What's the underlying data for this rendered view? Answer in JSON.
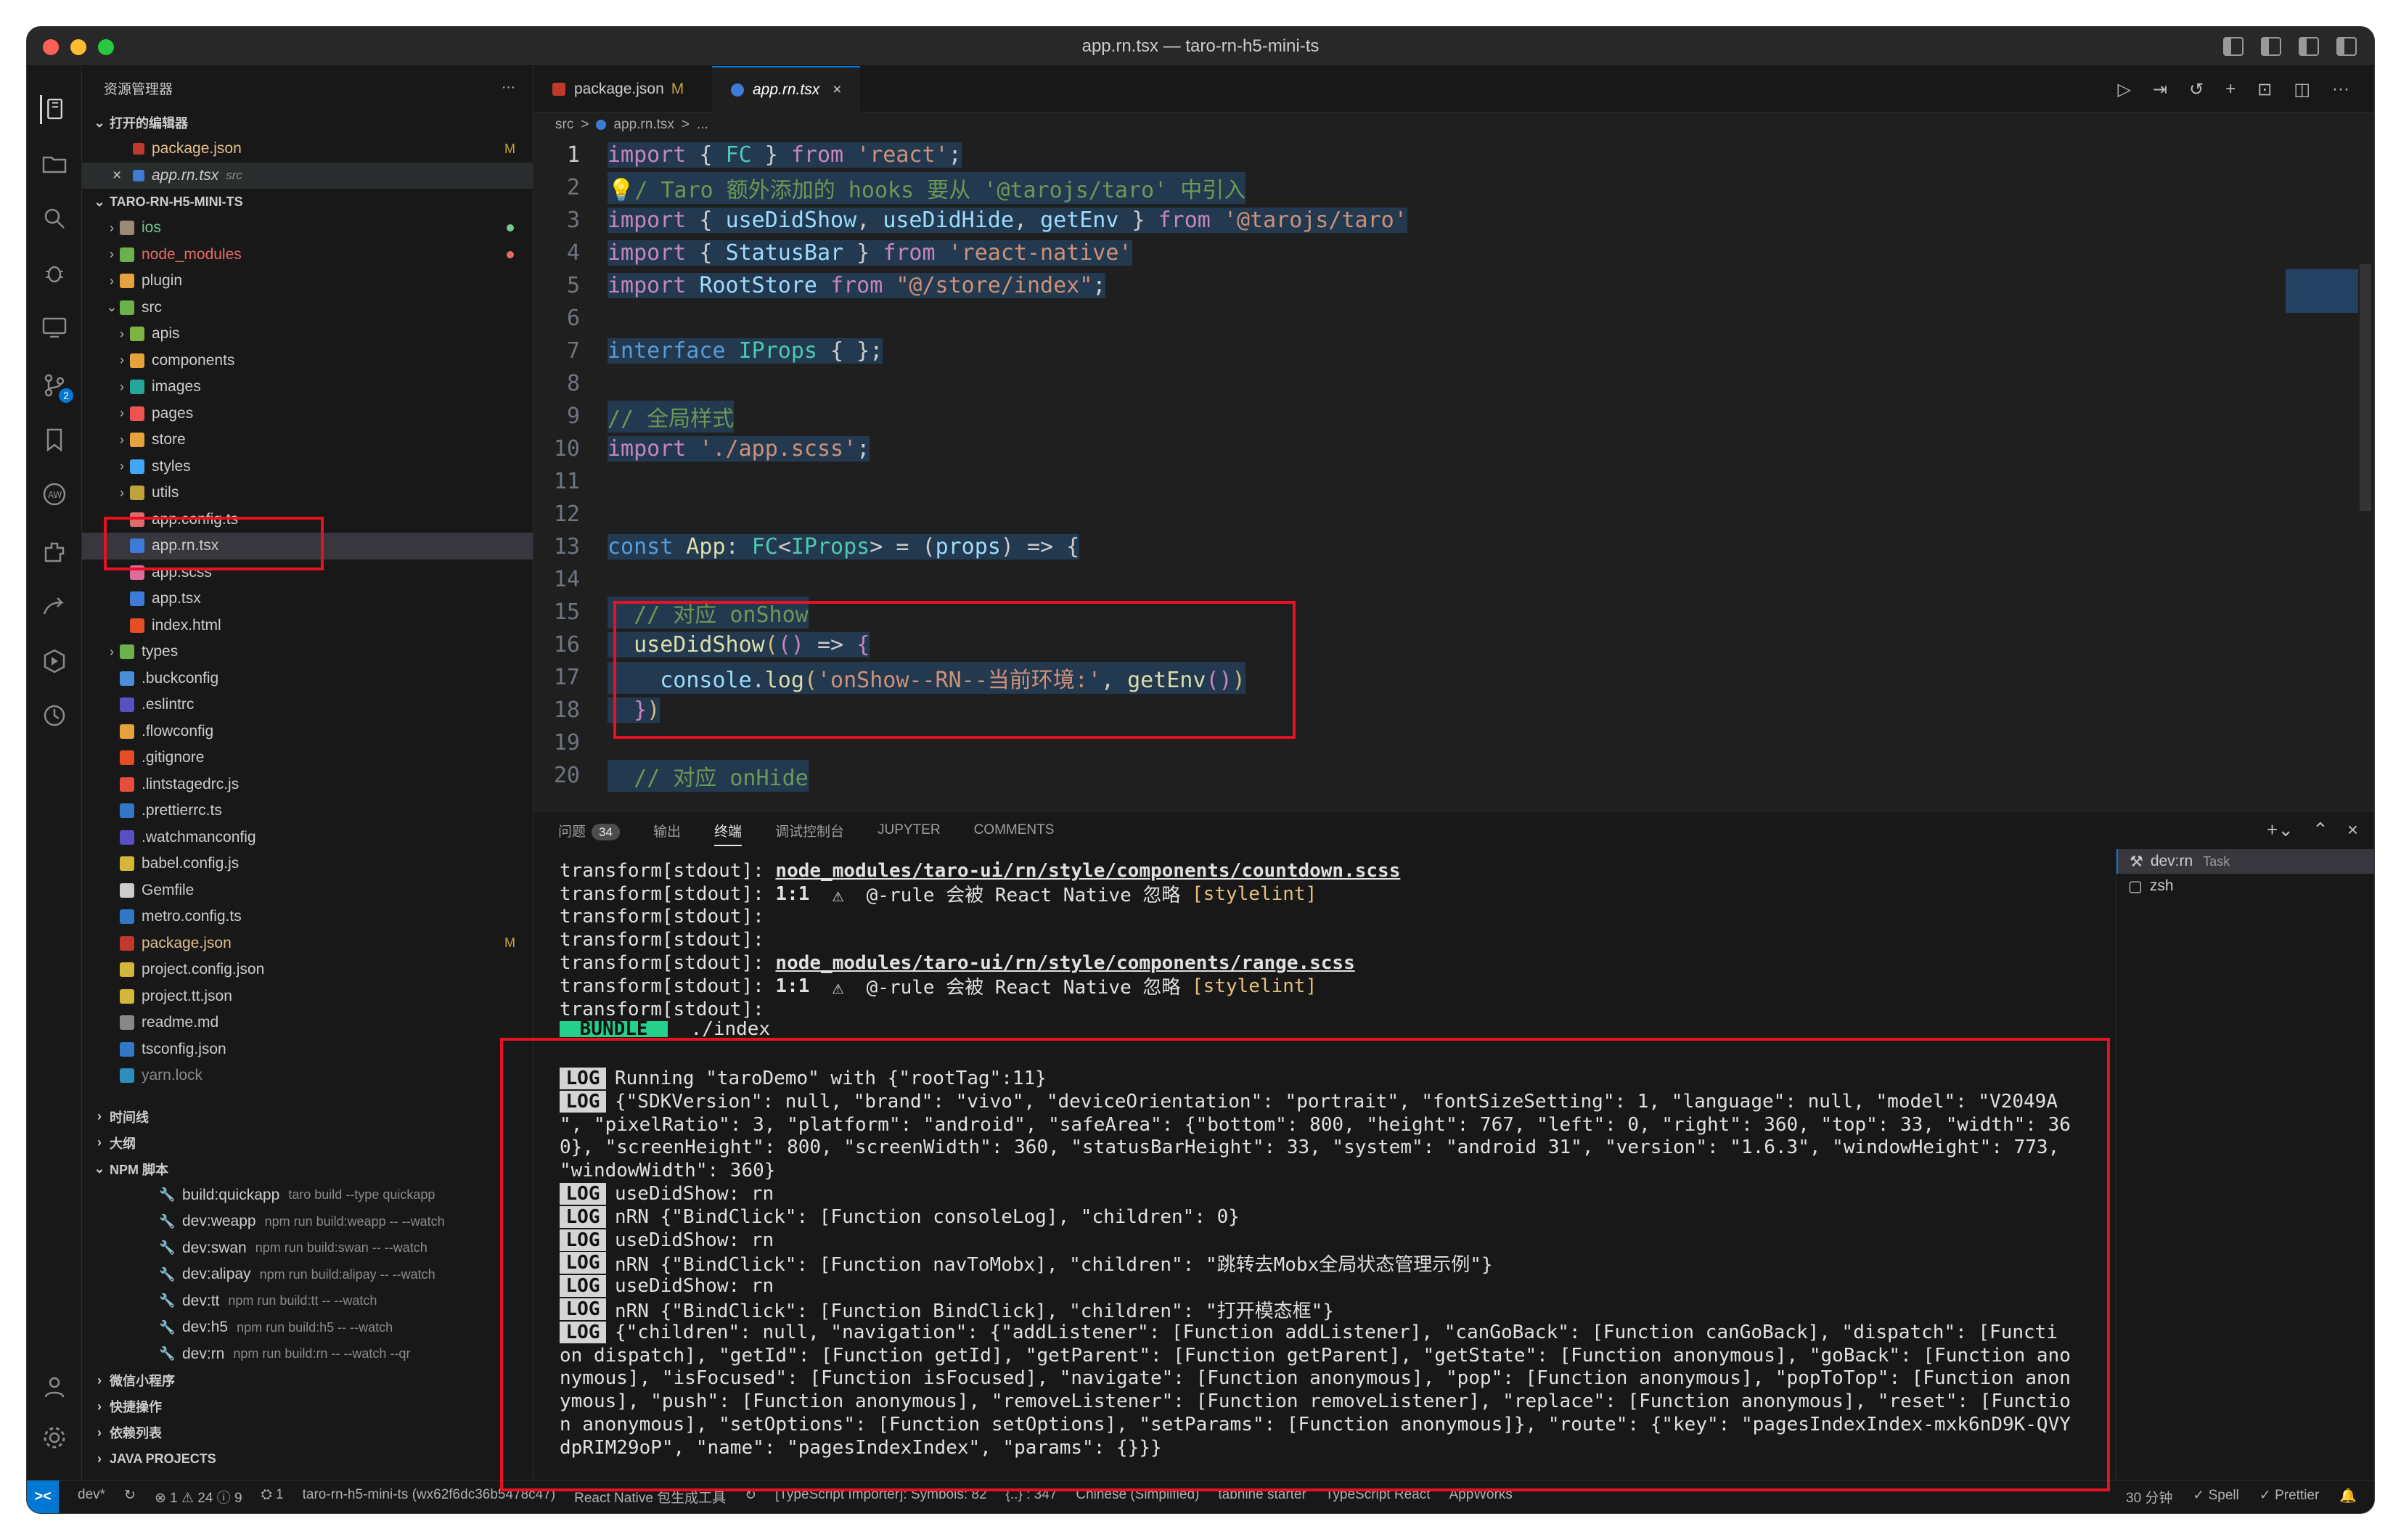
{
  "window": {
    "title": "app.rn.tsx — taro-rn-h5-mini-ts"
  },
  "explorer": {
    "heading": "资源管理器",
    "more": "···",
    "open_editors_label": "打开的编辑器",
    "open_editors": [
      {
        "name": "package.json",
        "badge": "M"
      },
      {
        "name": "app.rn.tsx",
        "hint": "src"
      }
    ],
    "project_label": "TARO-RN-H5-MINI-TS",
    "tree": [
      {
        "name": "ios",
        "chev": "›",
        "indent": 0,
        "color": "#73c991",
        "icon": "#9a8b78",
        "dot": "#73c991"
      },
      {
        "name": "node_modules",
        "chev": "›",
        "indent": 0,
        "color": "#e66a6a",
        "icon": "#6ab04c",
        "dot": "#e66a6a"
      },
      {
        "name": "plugin",
        "chev": "›",
        "indent": 0,
        "color": "#cccccc",
        "icon": "#e6a23c"
      },
      {
        "name": "src",
        "chev": "⌄",
        "indent": 0,
        "color": "#cccccc",
        "icon": "#6ab04c"
      },
      {
        "name": "apis",
        "chev": "›",
        "indent": 1,
        "color": "#cccccc",
        "icon": "#7cb342"
      },
      {
        "name": "components",
        "chev": "›",
        "indent": 1,
        "color": "#cccccc",
        "icon": "#e6a23c"
      },
      {
        "name": "images",
        "chev": "›",
        "indent": 1,
        "color": "#cccccc",
        "icon": "#26a69a"
      },
      {
        "name": "pages",
        "chev": "›",
        "indent": 1,
        "color": "#cccccc",
        "icon": "#ef5350"
      },
      {
        "name": "store",
        "chev": "›",
        "indent": 1,
        "color": "#cccccc",
        "icon": "#e6a23c"
      },
      {
        "name": "styles",
        "chev": "›",
        "indent": 1,
        "color": "#cccccc",
        "icon": "#42a5f5"
      },
      {
        "name": "utils",
        "chev": "›",
        "indent": 1,
        "color": "#cccccc",
        "icon": "#c0a23c"
      },
      {
        "name": "app.config.ts",
        "chev": "",
        "indent": 1,
        "color": "#cccccc",
        "icon": "#e06c6c"
      },
      {
        "name": "app.rn.tsx",
        "chev": "",
        "indent": 1,
        "color": "#cccccc",
        "icon": "#3d7bd9",
        "selected": true
      },
      {
        "name": "app.scss",
        "chev": "",
        "indent": 1,
        "color": "#cccccc",
        "icon": "#e06c9f"
      },
      {
        "name": "app.tsx",
        "chev": "",
        "indent": 1,
        "color": "#cccccc",
        "icon": "#3d7bd9"
      },
      {
        "name": "index.html",
        "chev": "",
        "indent": 1,
        "color": "#cccccc",
        "icon": "#e44d26"
      },
      {
        "name": "types",
        "chev": "›",
        "indent": 0,
        "color": "#cccccc",
        "icon": "#6ab04c"
      },
      {
        "name": ".buckconfig",
        "chev": "",
        "indent": 0,
        "color": "#cccccc",
        "icon": "#4a90d9"
      },
      {
        "name": ".eslintrc",
        "chev": "",
        "indent": 0,
        "color": "#cccccc",
        "icon": "#5b4fc4"
      },
      {
        "name": ".flowconfig",
        "chev": "",
        "indent": 0,
        "color": "#cccccc",
        "icon": "#e6a23c"
      },
      {
        "name": ".gitignore",
        "chev": "",
        "indent": 0,
        "color": "#cccccc",
        "icon": "#e44d26"
      },
      {
        "name": ".lintstagedrc.js",
        "chev": "",
        "indent": 0,
        "color": "#cccccc",
        "icon": "#e84c3d"
      },
      {
        "name": ".prettierrc.ts",
        "chev": "",
        "indent": 0,
        "color": "#cccccc",
        "icon": "#3178c6"
      },
      {
        "name": ".watchmanconfig",
        "chev": "",
        "indent": 0,
        "color": "#cccccc",
        "icon": "#5b4fc4"
      },
      {
        "name": "babel.config.js",
        "chev": "",
        "indent": 0,
        "color": "#cccccc",
        "icon": "#d4b73a"
      },
      {
        "name": "Gemfile",
        "chev": "",
        "indent": 0,
        "color": "#cccccc",
        "icon": "#cccccc"
      },
      {
        "name": "metro.config.ts",
        "chev": "",
        "indent": 0,
        "color": "#cccccc",
        "icon": "#3178c6"
      },
      {
        "name": "package.json",
        "chev": "",
        "indent": 0,
        "color": "#e2c08d",
        "icon": "#c0392b",
        "badge": "M"
      },
      {
        "name": "project.config.json",
        "chev": "",
        "indent": 0,
        "color": "#cccccc",
        "icon": "#d4b73a"
      },
      {
        "name": "project.tt.json",
        "chev": "",
        "indent": 0,
        "color": "#cccccc",
        "icon": "#d4b73a"
      },
      {
        "name": "readme.md",
        "chev": "",
        "indent": 0,
        "color": "#cccccc",
        "icon": "#888888"
      },
      {
        "name": "tsconfig.json",
        "chev": "",
        "indent": 0,
        "color": "#cccccc",
        "icon": "#3178c6"
      },
      {
        "name": "yarn.lock",
        "chev": "",
        "indent": 0,
        "color": "#8b8b8b",
        "icon": "#2c8ebb"
      }
    ],
    "sections": [
      {
        "label": "时间线",
        "chev": "›"
      },
      {
        "label": "大纲",
        "chev": "›"
      },
      {
        "label": "NPM 脚本",
        "chev": "⌄"
      }
    ],
    "npm_scripts": [
      {
        "name": "build:quickapp",
        "cmd": "taro build --type quickapp"
      },
      {
        "name": "dev:weapp",
        "cmd": "npm run build:weapp -- --watch"
      },
      {
        "name": "dev:swan",
        "cmd": "npm run build:swan -- --watch"
      },
      {
        "name": "dev:alipay",
        "cmd": "npm run build:alipay -- --watch"
      },
      {
        "name": "dev:tt",
        "cmd": "npm run build:tt -- --watch"
      },
      {
        "name": "dev:h5",
        "cmd": "npm run build:h5 -- --watch"
      },
      {
        "name": "dev:rn",
        "cmd": "npm run build:rn -- --watch --qr"
      }
    ],
    "bottom_sections": [
      {
        "label": "微信小程序",
        "chev": "›"
      },
      {
        "label": "快捷操作",
        "chev": "›"
      },
      {
        "label": "依赖列表",
        "chev": "›"
      },
      {
        "label": "JAVA PROJECTS",
        "chev": "›"
      }
    ]
  },
  "activity_bar": {
    "items": [
      "explorer-icon",
      "folder-icon",
      "search-icon",
      "debug-icon",
      "remote-explorer-icon",
      "source-control-icon",
      "bookmark-icon",
      "aws-icon",
      "extensions-icon",
      "liveshare-icon",
      "testing-icon",
      "timeline-icon"
    ],
    "bottom": [
      "account-icon",
      "settings-gear-icon"
    ],
    "scm_badge": "2"
  },
  "editor": {
    "tabs": [
      {
        "name": "package.json",
        "badge": "M"
      },
      {
        "name": "app.rn.tsx",
        "close": "×",
        "active": true
      }
    ],
    "breadcrumb": [
      "src",
      ">",
      "app.rn.tsx",
      ">",
      "..."
    ],
    "lines": [
      {
        "n": "1",
        "cur": true,
        "tokens": [
          [
            "kw2",
            "import"
          ],
          [
            "pn",
            " { "
          ],
          [
            "ty",
            "FC"
          ],
          [
            "pn",
            " } "
          ],
          [
            "kw2",
            "from"
          ],
          [
            "pn",
            " "
          ],
          [
            "str",
            "'react'"
          ],
          [
            "pn",
            ";"
          ]
        ]
      },
      {
        "n": "2",
        "tokens": [
          [
            "cm",
            "💡/ Taro 额外添加的 hooks 要从 '@tarojs/taro' 中引入"
          ]
        ]
      },
      {
        "n": "3",
        "tokens": [
          [
            "kw2",
            "import"
          ],
          [
            "pn",
            " { "
          ],
          [
            "vr",
            "useDidShow"
          ],
          [
            "pn",
            ", "
          ],
          [
            "vr",
            "useDidHide"
          ],
          [
            "pn",
            ", "
          ],
          [
            "vr",
            "getEnv"
          ],
          [
            "pn",
            " } "
          ],
          [
            "kw2",
            "from"
          ],
          [
            "pn",
            " "
          ],
          [
            "str",
            "'@tarojs/taro'"
          ]
        ]
      },
      {
        "n": "4",
        "tokens": [
          [
            "kw2",
            "import"
          ],
          [
            "pn",
            " { "
          ],
          [
            "vr",
            "StatusBar"
          ],
          [
            "pn",
            " } "
          ],
          [
            "kw2",
            "from"
          ],
          [
            "pn",
            " "
          ],
          [
            "str",
            "'react-native'"
          ]
        ]
      },
      {
        "n": "5",
        "tokens": [
          [
            "kw2",
            "import"
          ],
          [
            "pn",
            " "
          ],
          [
            "vr",
            "RootStore"
          ],
          [
            "pn",
            " "
          ],
          [
            "kw2",
            "from"
          ],
          [
            "pn",
            " "
          ],
          [
            "str",
            "\"@/store/index\""
          ],
          [
            "pn",
            ";"
          ]
        ]
      },
      {
        "n": "6",
        "tokens": []
      },
      {
        "n": "7",
        "tokens": [
          [
            "kw",
            "interface"
          ],
          [
            "pn",
            " "
          ],
          [
            "ty",
            "IProps"
          ],
          [
            "pn",
            " { };"
          ]
        ]
      },
      {
        "n": "8",
        "tokens": []
      },
      {
        "n": "9",
        "tokens": [
          [
            "cm",
            "// 全局样式"
          ]
        ]
      },
      {
        "n": "10",
        "tokens": [
          [
            "kw2",
            "import"
          ],
          [
            "pn",
            " "
          ],
          [
            "str",
            "'./app.scss'"
          ],
          [
            "pn",
            ";"
          ]
        ]
      },
      {
        "n": "11",
        "tokens": []
      },
      {
        "n": "12",
        "tokens": []
      },
      {
        "n": "13",
        "tokens": [
          [
            "kw",
            "const"
          ],
          [
            "pn",
            " "
          ],
          [
            "fn",
            "App"
          ],
          [
            "pn",
            ": "
          ],
          [
            "ty",
            "FC"
          ],
          [
            "pn",
            "<"
          ],
          [
            "ty",
            "IProps"
          ],
          [
            "pn",
            "> = ("
          ],
          [
            "vr",
            "props"
          ],
          [
            "pn",
            ") => {"
          ]
        ]
      },
      {
        "n": "14",
        "tokens": []
      },
      {
        "n": "15",
        "tokens": [
          [
            "pn",
            "  "
          ],
          [
            "cm",
            "// 对应 onShow"
          ]
        ]
      },
      {
        "n": "16",
        "tokens": [
          [
            "pn",
            "  "
          ],
          [
            "fn",
            "useDidShow"
          ],
          [
            "yel",
            "("
          ],
          [
            "kw2",
            "()"
          ],
          [
            "pn",
            " => "
          ],
          [
            "kw2",
            "{"
          ]
        ]
      },
      {
        "n": "17",
        "tokens": [
          [
            "pn",
            "    "
          ],
          [
            "vr",
            "console"
          ],
          [
            "pn",
            "."
          ],
          [
            "fn",
            "log"
          ],
          [
            "yel",
            "("
          ],
          [
            "str",
            "'onShow--RN--当前环境:'"
          ],
          [
            "pn",
            ", "
          ],
          [
            "fn",
            "getEnv"
          ],
          [
            "kw2",
            "()"
          ],
          [
            "yel",
            ")"
          ]
        ]
      },
      {
        "n": "18",
        "tokens": [
          [
            "pn",
            "  "
          ],
          [
            "kw2",
            "}"
          ],
          [
            "yel",
            ")"
          ]
        ]
      },
      {
        "n": "19",
        "tokens": []
      },
      {
        "n": "20",
        "tokens": [
          [
            "pn",
            "  "
          ],
          [
            "cm",
            "// 对应 onHide"
          ]
        ]
      }
    ]
  },
  "panel": {
    "tabs": [
      {
        "label": "问题",
        "count": "34"
      },
      {
        "label": "输出"
      },
      {
        "label": "终端",
        "active": true
      },
      {
        "label": "调试控制台"
      },
      {
        "label": "JUPYTER"
      },
      {
        "label": "COMMENTS"
      }
    ],
    "terminal_lines": [
      {
        "type": "tr",
        "prefix": "transform[stdout]: ",
        "link": "node_modules/taro-ui/rn/style/components/countdown.scss"
      },
      {
        "type": "tw",
        "prefix": "transform[stdout]: ",
        "loc": "1:1",
        "warn": "  ⚠  @-rule 会被 React Native 忽略 ",
        "tag": "[stylelint]"
      },
      {
        "type": "plain",
        "text": "transform[stdout]:"
      },
      {
        "type": "plain",
        "text": "transform[stdout]:"
      },
      {
        "type": "tr",
        "prefix": "transform[stdout]: ",
        "link": "node_modules/taro-ui/rn/style/components/range.scss"
      },
      {
        "type": "tw",
        "prefix": "transform[stdout]: ",
        "loc": "1:1",
        "warn": "  ⚠  @-rule 会被 React Native 忽略 ",
        "tag": "[stylelint]"
      },
      {
        "type": "plain",
        "text": "transform[stdout]:"
      },
      {
        "type": "bundle",
        "label": " BUNDLE ",
        "text": "  ./index"
      },
      {
        "type": "blank"
      },
      {
        "type": "log",
        "text": "Running \"taroDemo\" with {\"rootTag\":11}"
      },
      {
        "type": "log",
        "text": "{\"SDKVersion\": null, \"brand\": \"vivo\", \"deviceOrientation\": \"portrait\", \"fontSizeSetting\": 1, \"language\": null, \"model\": \"V2049A"
      },
      {
        "type": "cont",
        "text": "\", \"pixelRatio\": 3, \"platform\": \"android\", \"safeArea\": {\"bottom\": 800, \"height\": 767, \"left\": 0, \"right\": 360, \"top\": 33, \"width\": 36"
      },
      {
        "type": "cont",
        "text": "0}, \"screenHeight\": 800, \"screenWidth\": 360, \"statusBarHeight\": 33, \"system\": \"android 31\", \"version\": \"1.6.3\", \"windowHeight\": 773,"
      },
      {
        "type": "cont",
        "text": "\"windowWidth\": 360}"
      },
      {
        "type": "log",
        "text": "useDidShow: rn"
      },
      {
        "type": "log",
        "text": "nRN {\"BindClick\": [Function consoleLog], \"children\": 0}"
      },
      {
        "type": "log",
        "text": "useDidShow: rn"
      },
      {
        "type": "log",
        "text": "nRN {\"BindClick\": [Function navToMobx], \"children\": \"跳转去Mobx全局状态管理示例\"}"
      },
      {
        "type": "log",
        "text": "useDidShow: rn"
      },
      {
        "type": "log",
        "text": "nRN {\"BindClick\": [Function BindClick], \"children\": \"打开模态框\"}"
      },
      {
        "type": "log",
        "text": "{\"children\": null, \"navigation\": {\"addListener\": [Function addListener], \"canGoBack\": [Function canGoBack], \"dispatch\": [Functi"
      },
      {
        "type": "cont",
        "text": "on dispatch], \"getId\": [Function getId], \"getParent\": [Function getParent], \"getState\": [Function anonymous], \"goBack\": [Function ano"
      },
      {
        "type": "cont",
        "text": "nymous], \"isFocused\": [Function isFocused], \"navigate\": [Function anonymous], \"pop\": [Function anonymous], \"popToTop\": [Function anon"
      },
      {
        "type": "cont",
        "text": "ymous], \"push\": [Function anonymous], \"removeListener\": [Function removeListener], \"replace\": [Function anonymous], \"reset\": [Functio"
      },
      {
        "type": "cont",
        "text": "n anonymous], \"setOptions\": [Function setOptions], \"setParams\": [Function anonymous]}, \"route\": {\"key\": \"pagesIndexIndex-mxk6nD9K-QVY"
      },
      {
        "type": "cont",
        "text": "dpRIM29oP\", \"name\": \"pagesIndexIndex\", \"params\": {}}}"
      }
    ],
    "log_tag": "LOG",
    "terminals": [
      {
        "name": "dev:rn",
        "sub": "Task",
        "active": true
      },
      {
        "name": "zsh"
      }
    ]
  },
  "statusbar": {
    "remote": "><",
    "left": [
      "dev*",
      "↻",
      "⊗ 1 ⚠ 24 ⓘ 9",
      "⛭ 1",
      "taro-rn-h5-mini-ts (wx62f6dc36b5478c47)",
      "React Native 包生成工具",
      "↻",
      "[TypeScript Importer]: Symbols: 82",
      "{..} : 347",
      "Chinese (Simplified)",
      "tabnine starter",
      "TypeScript React",
      "AppWorks"
    ],
    "right": [
      "30 分钟",
      "✓ Spell",
      "✓ Prettier",
      "🔔"
    ]
  }
}
